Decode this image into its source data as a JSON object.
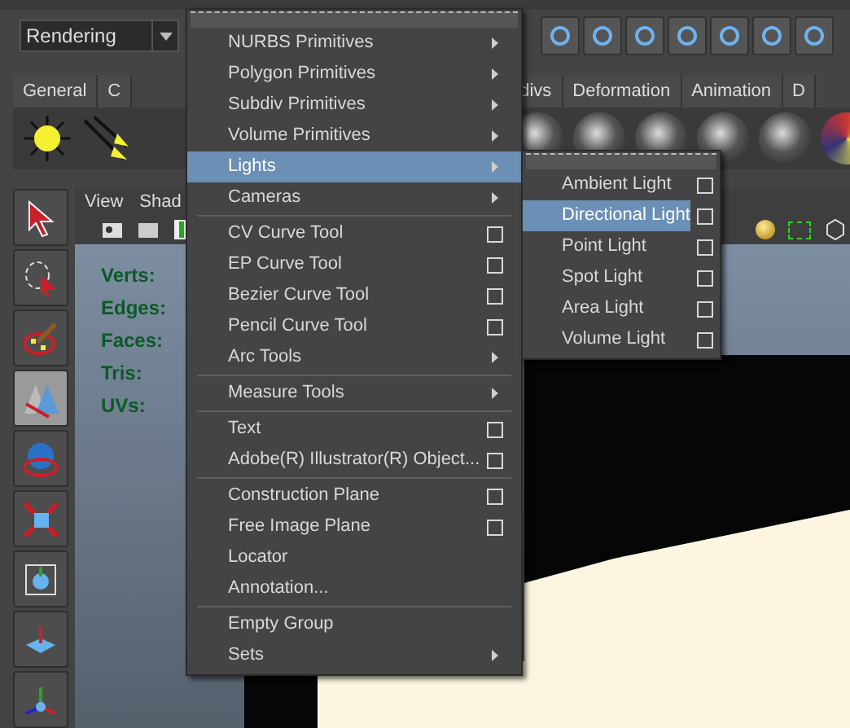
{
  "menu_set": {
    "value": "Rendering"
  },
  "shelf_tabs": [
    {
      "label": "General",
      "selected": false
    },
    {
      "label": "C",
      "selected": false
    },
    {
      "label": "divs",
      "selected": false
    },
    {
      "label": "Deformation",
      "selected": false
    },
    {
      "label": "Animation",
      "selected": false
    },
    {
      "label": "D",
      "selected": false
    }
  ],
  "panel_menu": [
    "View",
    "Shad"
  ],
  "hud": [
    "Verts:",
    "Edges:",
    "Faces:",
    "Tris:",
    "UVs:"
  ],
  "toolbox": [
    {
      "selected": false
    },
    {
      "selected": false
    },
    {
      "selected": false
    },
    {
      "selected": true
    },
    {
      "selected": false
    },
    {
      "selected": false
    },
    {
      "selected": false
    },
    {
      "selected": false
    },
    {
      "selected": false
    }
  ],
  "create_menu": [
    {
      "kind": "item",
      "label": "NURBS Primitives",
      "submenu": true,
      "option_box": false,
      "selected": false
    },
    {
      "kind": "item",
      "label": "Polygon Primitives",
      "submenu": true,
      "option_box": false,
      "selected": false
    },
    {
      "kind": "item",
      "label": "Subdiv Primitives",
      "submenu": true,
      "option_box": false,
      "selected": false
    },
    {
      "kind": "item",
      "label": "Volume Primitives",
      "submenu": true,
      "option_box": false,
      "selected": false
    },
    {
      "kind": "item",
      "label": "Lights",
      "submenu": true,
      "option_box": false,
      "selected": true
    },
    {
      "kind": "item",
      "label": "Cameras",
      "submenu": true,
      "option_box": false,
      "selected": false
    },
    {
      "kind": "separator"
    },
    {
      "kind": "item",
      "label": "CV Curve Tool",
      "submenu": false,
      "option_box": true,
      "selected": false
    },
    {
      "kind": "item",
      "label": "EP Curve Tool",
      "submenu": false,
      "option_box": true,
      "selected": false
    },
    {
      "kind": "item",
      "label": "Bezier Curve Tool",
      "submenu": false,
      "option_box": true,
      "selected": false
    },
    {
      "kind": "item",
      "label": "Pencil Curve Tool",
      "submenu": false,
      "option_box": true,
      "selected": false
    },
    {
      "kind": "item",
      "label": "Arc Tools",
      "submenu": true,
      "option_box": false,
      "selected": false
    },
    {
      "kind": "separator"
    },
    {
      "kind": "item",
      "label": "Measure Tools",
      "submenu": true,
      "option_box": false,
      "selected": false
    },
    {
      "kind": "separator"
    },
    {
      "kind": "item",
      "label": "Text",
      "submenu": false,
      "option_box": true,
      "selected": false
    },
    {
      "kind": "item",
      "label": "Adobe(R) Illustrator(R) Object...",
      "submenu": false,
      "option_box": true,
      "selected": false
    },
    {
      "kind": "separator"
    },
    {
      "kind": "item",
      "label": "Construction Plane",
      "submenu": false,
      "option_box": true,
      "selected": false
    },
    {
      "kind": "item",
      "label": "Free Image Plane",
      "submenu": false,
      "option_box": true,
      "selected": false
    },
    {
      "kind": "item",
      "label": "Locator",
      "submenu": false,
      "option_box": false,
      "selected": false
    },
    {
      "kind": "item",
      "label": "Annotation...",
      "submenu": false,
      "option_box": false,
      "selected": false
    },
    {
      "kind": "separator"
    },
    {
      "kind": "item",
      "label": "Empty Group",
      "submenu": false,
      "option_box": false,
      "selected": false
    },
    {
      "kind": "item",
      "label": "Sets",
      "submenu": true,
      "option_box": false,
      "selected": false
    }
  ],
  "lights_submenu": [
    {
      "label": "Ambient Light",
      "option_box": true,
      "selected": false
    },
    {
      "label": "Directional Light",
      "option_box": true,
      "selected": true
    },
    {
      "label": "Point Light",
      "option_box": true,
      "selected": false
    },
    {
      "label": "Spot Light",
      "option_box": true,
      "selected": false
    },
    {
      "label": "Area Light",
      "option_box": true,
      "selected": false
    },
    {
      "label": "Volume Light",
      "option_box": true,
      "selected": false
    }
  ]
}
